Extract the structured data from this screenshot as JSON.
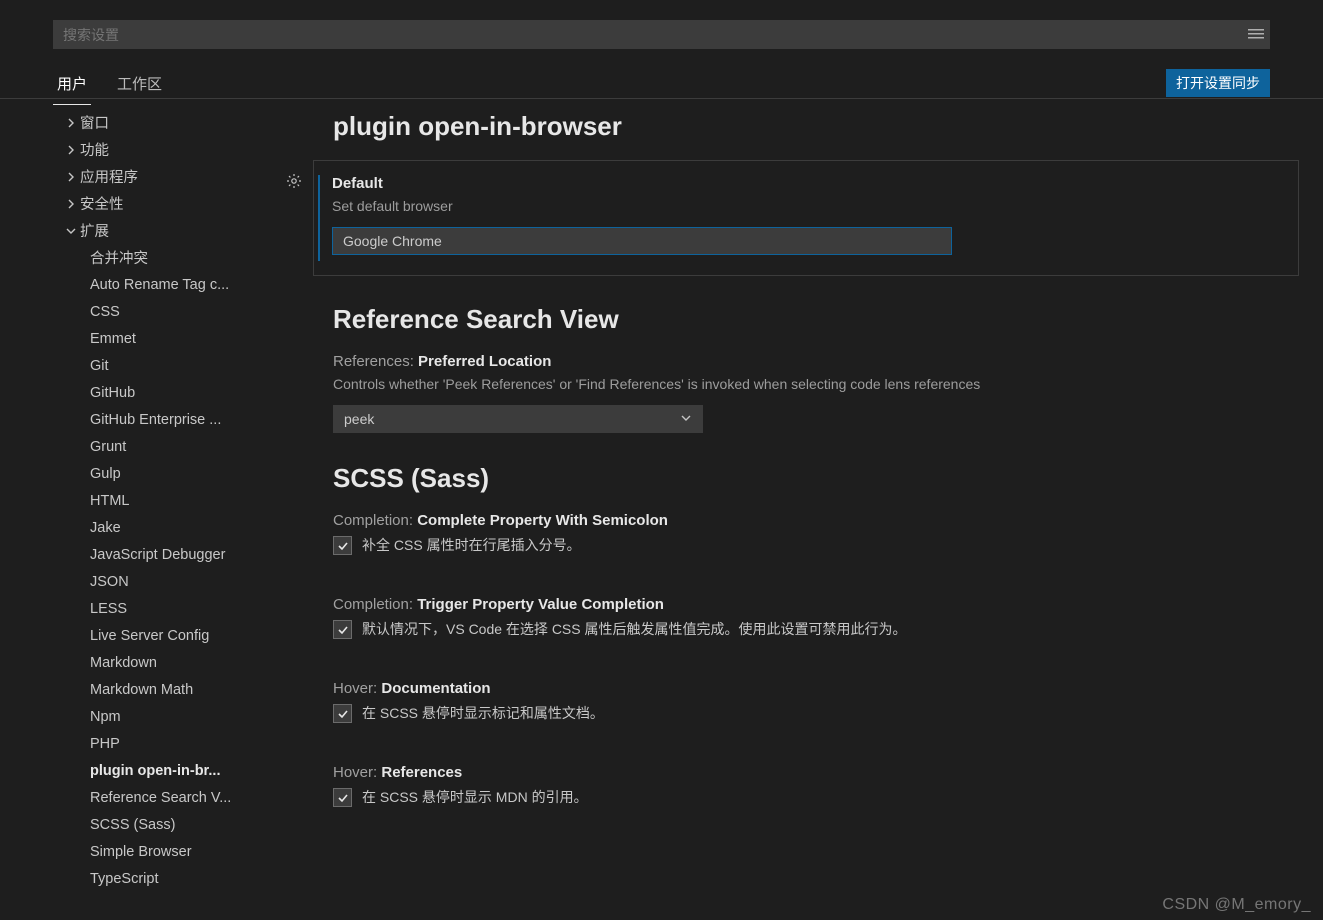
{
  "search": {
    "placeholder": "搜索设置"
  },
  "tabs": {
    "user": "用户",
    "workspace": "工作区"
  },
  "sync_button": "打开设置同步",
  "sidebar": {
    "groups": {
      "window": "窗口",
      "features": "功能",
      "applications": "应用程序",
      "security": "安全性",
      "extensions": "扩展"
    },
    "ext_items": [
      "合并冲突",
      "Auto Rename Tag c...",
      "CSS",
      "Emmet",
      "Git",
      "GitHub",
      "GitHub Enterprise ...",
      "Grunt",
      "Gulp",
      "HTML",
      "Jake",
      "JavaScript Debugger",
      "JSON",
      "LESS",
      "Live Server Config",
      "Markdown",
      "Markdown Math",
      "Npm",
      "PHP",
      "plugin open-in-br...",
      "Reference Search V...",
      "SCSS (Sass)",
      "Simple Browser",
      "TypeScript"
    ],
    "active_index": 19
  },
  "sections": {
    "plugin": {
      "title": "plugin open-in-browser",
      "default": {
        "label": "Default",
        "desc": "Set default browser",
        "value": "Google Chrome"
      }
    },
    "refsearch": {
      "title": "Reference Search View",
      "pref": {
        "prefix": "References:",
        "name": "Preferred Location",
        "desc": "Controls whether 'Peek References' or 'Find References' is invoked when selecting code lens references",
        "value": "peek"
      }
    },
    "scss": {
      "title": "SCSS (Sass)",
      "complete_semicolon": {
        "prefix": "Completion:",
        "name": "Complete Property With Semicolon",
        "desc": "补全 CSS 属性时在行尾插入分号。",
        "checked": true
      },
      "trigger_value": {
        "prefix": "Completion:",
        "name": "Trigger Property Value Completion",
        "desc": "默认情况下，VS Code 在选择 CSS 属性后触发属性值完成。使用此设置可禁用此行为。",
        "checked": true
      },
      "hover_doc": {
        "prefix": "Hover:",
        "name": "Documentation",
        "desc": "在 SCSS 悬停时显示标记和属性文档。",
        "checked": true
      },
      "hover_ref": {
        "prefix": "Hover:",
        "name": "References",
        "desc": "在 SCSS 悬停时显示 MDN 的引用。",
        "checked": true
      }
    }
  },
  "watermark": "CSDN @M_emory_"
}
